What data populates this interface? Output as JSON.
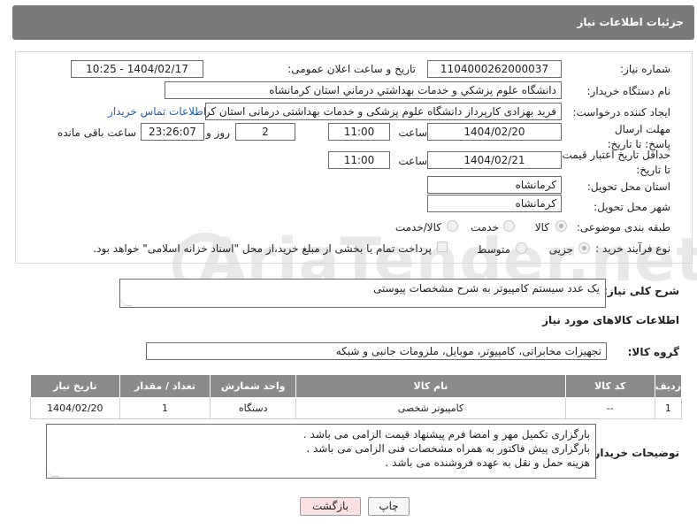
{
  "header": {
    "title": "جزئیات اطلاعات نیاز"
  },
  "labels": {
    "need_number": "شماره نیاز:",
    "announce_datetime": "تاریخ و ساعت اعلان عمومی:",
    "buyer_org": "نام دستگاه خریدار:",
    "requester": "ایجاد کننده درخواست:",
    "reply_deadline": "مهلت ارسال پاسخ: تا تاریخ:",
    "time": "ساعت",
    "days_and": "روز و",
    "remaining": "ساعت باقی مانده",
    "price_validity": "حداقل تاریخ اعتبار قیمت: تا تاریخ:",
    "province": "استان محل تحویل:",
    "city": "شهر محل تحویل:",
    "category": "طبقه بندی موضوعی:",
    "process": "نوع فرآیند خرید :",
    "description": "شرح کلی نیاز:",
    "goods_info": "اطلاعات کالاهای مورد نیاز",
    "goods_group": "گروه کالا:",
    "buyer_notes": "توضیحات خریدار:"
  },
  "fields": {
    "need_number": "1104000262000037",
    "announce_datetime": "1404/02/17 - 10:25",
    "buyer_org": "دانشگاه علوم پزشکي و خدمات بهداشتي  درماني استان کرمانشاه",
    "requester": "فرید  بهزادی کارپرداز دانشگاه علوم پزشکی و خدمات بهداشتی  درمانی استان کرمانشاه",
    "contact_link": "اطلاعات تماس خریدار",
    "reply_date": "1404/02/20",
    "reply_time": "11:00",
    "days": "2",
    "remaining_time": "23:26:07",
    "price_date": "1404/02/21",
    "price_time": "11:00",
    "province": "کرمانشاه",
    "city": "کرمانشاه",
    "description": "یک عدد سیستم کامپیوتر به شرح مشخصات پیوستی",
    "goods_group": "تجهیزات مخابراتی، کامپیوتر، موبایل، ملزومات جانبی و شبکه"
  },
  "category_options": [
    {
      "label": "کالا",
      "selected": true
    },
    {
      "label": "خدمت",
      "selected": false
    },
    {
      "label": "کالا/خدمت",
      "selected": false
    }
  ],
  "process_options": [
    {
      "label": "جزیی",
      "selected": true
    },
    {
      "label": "متوسط",
      "selected": false
    }
  ],
  "payment_note": "پرداخت تمام یا بخشی از مبلغ خرید،از محل \"اسناد خزانه اسلامی\" خواهد بود.",
  "table": {
    "headers": [
      "ردیف",
      "کد کالا",
      "نام کالا",
      "واحد شمارش",
      "تعداد / مقدار",
      "تاریخ نیاز"
    ],
    "rows": [
      [
        "1",
        "--",
        "کامپیوتر شخصی",
        "دستگاه",
        "1",
        "1404/02/20"
      ]
    ]
  },
  "buyer_notes": [
    "بارگزاری تکمیل مهر و امضا فرم پیشنهاد قیمت الزامی می باشد .",
    "بارگزاری پیش فاکتور به همراه مشخصات فنی الزامی می باشد .",
    "هزینه حمل و نقل به عهده فروشنده می باشد ."
  ],
  "buttons": {
    "print": "چاپ",
    "back": "بازگشت"
  },
  "watermark": "AriaTender.net",
  "colors": {
    "header_bg": "#7a7a7a",
    "table_header_bg": "#8a8a8a",
    "link": "#1c5fb0",
    "back_button_bg": "#fbe1e1"
  }
}
